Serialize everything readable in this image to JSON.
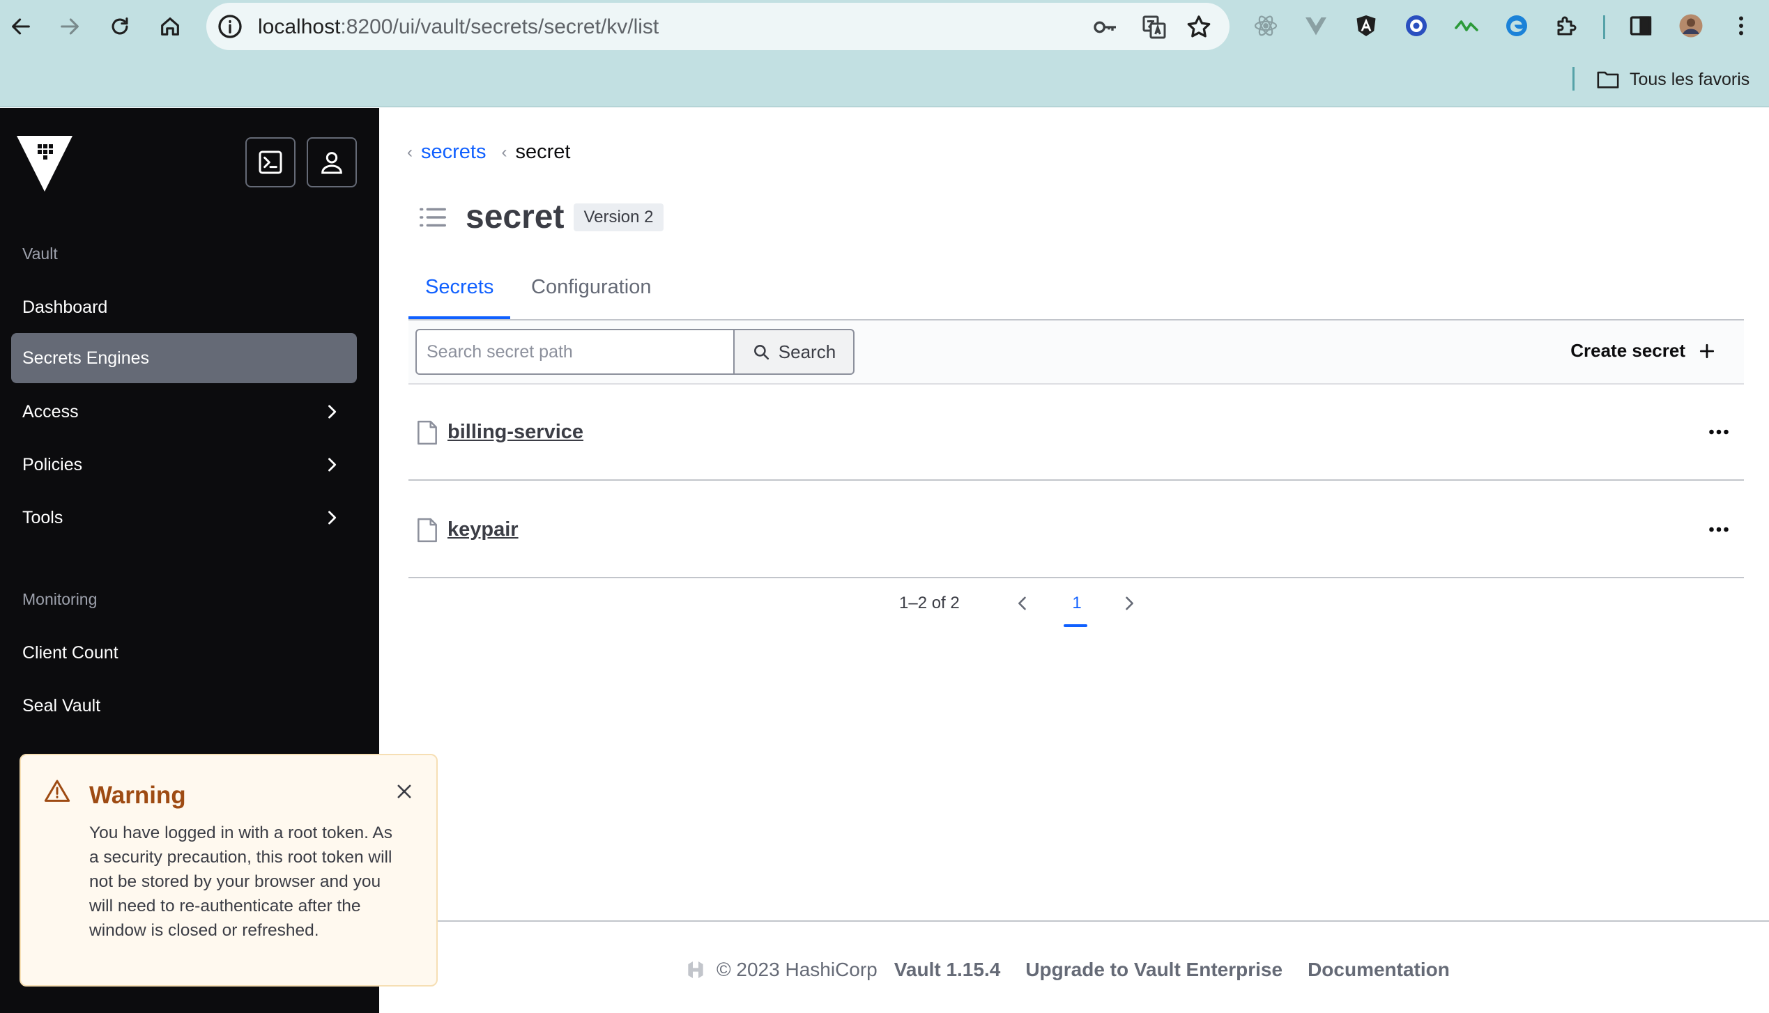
{
  "browser": {
    "url_host": "localhost",
    "url_path": ":8200/ui/vault/secrets/secret/kv/list",
    "favorites_label": "Tous les favoris"
  },
  "sidebar": {
    "heading_vault": "Vault",
    "heading_monitoring": "Monitoring",
    "items": [
      {
        "label": "Dashboard"
      },
      {
        "label": "Secrets Engines",
        "active": true
      },
      {
        "label": "Access",
        "chevron": true
      },
      {
        "label": "Policies",
        "chevron": true
      },
      {
        "label": "Tools",
        "chevron": true
      }
    ],
    "monitoring_items": [
      {
        "label": "Client Count"
      },
      {
        "label": "Seal Vault"
      }
    ]
  },
  "breadcrumb": {
    "parent": "secrets",
    "current": "secret"
  },
  "page": {
    "title": "secret",
    "version_badge": "Version 2"
  },
  "tabs": {
    "secrets": "Secrets",
    "configuration": "Configuration"
  },
  "toolbar": {
    "search_placeholder": "Search secret path",
    "search_label": "Search",
    "create_label": "Create secret"
  },
  "secrets_list": [
    {
      "name": "billing-service"
    },
    {
      "name": "keypair"
    }
  ],
  "pagination": {
    "range": "1–2 of 2",
    "current_page": "1"
  },
  "footer": {
    "copyright": "© 2023 HashiCorp",
    "version": "Vault 1.15.4",
    "upgrade": "Upgrade to Vault Enterprise",
    "docs": "Documentation"
  },
  "toast": {
    "title": "Warning",
    "message": "You have logged in with a root token. As a security precaution, this root token will not be stored by your browser and you will need to re-authenticate after the window is closed or refreshed."
  },
  "colors": {
    "accent": "#1060ff",
    "sidebar_bg": "#0c0c0e",
    "sidebar_active": "#656a76",
    "warning_title": "#9e4b13",
    "warning_bg": "#fff9ef",
    "chrome_bg": "#c2e0e2"
  }
}
